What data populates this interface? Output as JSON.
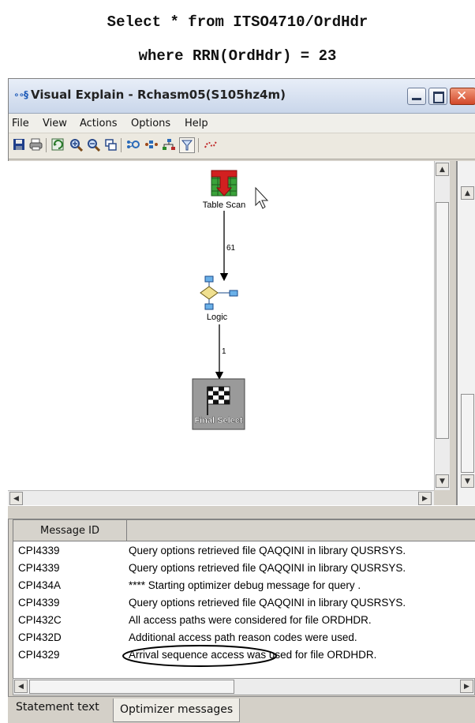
{
  "sql": {
    "line1": "Select * from ITSO4710/OrdHdr",
    "line2": "where RRN(OrdHdr) = 23"
  },
  "window": {
    "title": "Visual Explain - Rchasm05(S105hz4m)",
    "title_icon": "visual-explain-icon"
  },
  "menu": {
    "file": "File",
    "view": "View",
    "actions": "Actions",
    "options": "Options",
    "help": "Help"
  },
  "toolbar": {
    "icons": [
      "save-icon",
      "print-icon",
      "refresh-icon",
      "zoom-in-icon",
      "zoom-out-icon",
      "fit-icon",
      "graph-icon",
      "overview-icon",
      "tree-icon",
      "filter-icon",
      "highlight-icon"
    ]
  },
  "graph": {
    "nodes": [
      {
        "label": "Table Scan",
        "icon": "table-scan-icon"
      },
      {
        "label": "Logic",
        "icon": "logic-icon"
      },
      {
        "label": "Final Select",
        "icon": "final-select-icon"
      }
    ],
    "edges": [
      {
        "label": "61"
      },
      {
        "label": "1"
      }
    ]
  },
  "messages": {
    "header_id": "Message ID",
    "header_text": "",
    "rows": [
      {
        "id": "CPI4339",
        "text": "Query options retrieved file QAQQINI in library QUSRSYS."
      },
      {
        "id": "CPI4339",
        "text": "Query options retrieved file QAQQINI in library QUSRSYS."
      },
      {
        "id": "CPI434A",
        "text": "**** Starting optimizer debug message for query ."
      },
      {
        "id": "CPI4339",
        "text": "Query options retrieved file QAQQINI in library QUSRSYS."
      },
      {
        "id": "CPI432C",
        "text": "All access paths were considered for file ORDHDR."
      },
      {
        "id": "CPI432D",
        "text": "Additional access path reason codes were used."
      },
      {
        "id": "CPI4329",
        "text": "Arrival sequence access was used for file ORDHDR."
      }
    ]
  },
  "tabs": {
    "statement": "Statement text",
    "optimizer": "Optimizer messages"
  },
  "colors": {
    "titlebar": "#dbe3f0",
    "close_button": "#d9553a",
    "table_scan_green": "#3aa33a",
    "table_scan_red": "#d22020",
    "final_select_bg": "#9a9a9a"
  }
}
